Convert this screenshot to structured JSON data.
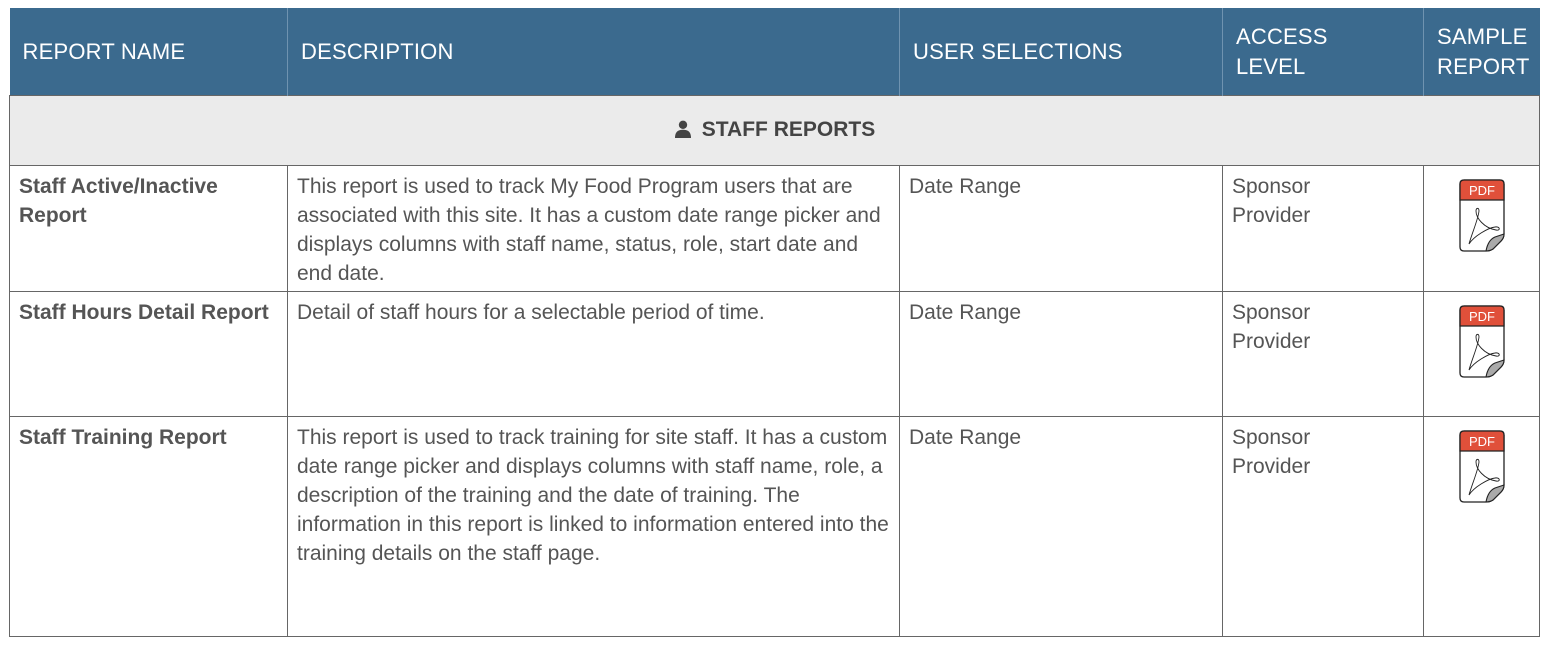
{
  "header": {
    "col_report_name": "REPORT NAME",
    "col_description": "DESCRIPTION",
    "col_user_selections": "USER SELECTIONS",
    "col_access_line1": "ACCESS",
    "col_access_line2": "LEVEL",
    "col_sample_line1": "SAMPLE",
    "col_sample_line2": "REPORT"
  },
  "section": {
    "title": "STAFF REPORTS",
    "icon": "user-icon"
  },
  "rows": [
    {
      "name": "Staff Active/Inactive Report",
      "description": "This report is used to track My Food Program users that are associated with this site. It has a custom date range picker and displays columns with staff name, status, role, start date and end date.",
      "selections": "Date Range",
      "access_line1": "Sponsor",
      "access_line2": "Provider",
      "sample_label": "PDF"
    },
    {
      "name": "Staff Hours Detail Report",
      "description": "Detail of staff hours for a selectable period of time.",
      "selections": "Date Range",
      "access_line1": "Sponsor",
      "access_line2": "Provider",
      "sample_label": "PDF"
    },
    {
      "name": "Staff Training Report",
      "description": "This report is used to track training for site staff. It has a custom date range picker and displays columns with staff name, role, a description of the training and the date of training. The information in this report is linked to information entered into the training details on the staff page.",
      "selections": "Date Range",
      "access_line1": "Sponsor",
      "access_line2": "Provider",
      "sample_label": "PDF"
    }
  ],
  "colors": {
    "header_bg": "#3b6a8e",
    "section_bg": "#ebebeb",
    "pdf_red": "#e0503a"
  }
}
